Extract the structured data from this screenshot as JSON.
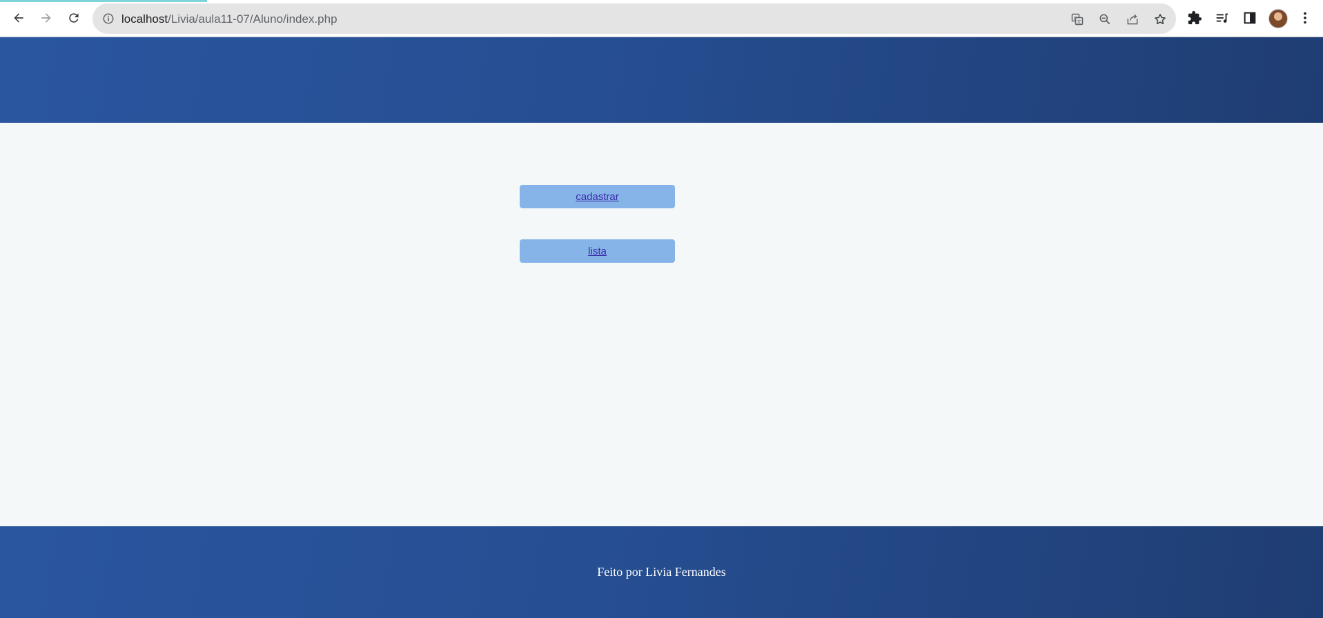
{
  "browser": {
    "url_host": "localhost",
    "url_path": "/Livia/aula11-07/Aluno/index.php",
    "icons": {
      "back": "arrow-left-icon",
      "forward": "arrow-right-icon",
      "reload": "reload-icon",
      "site_info": "info-icon",
      "translate": "translate-icon",
      "zoom": "zoom-out-icon",
      "share": "share-icon",
      "bookmark": "star-icon",
      "extensions": "puzzle-icon",
      "reading_list": "reading-list-icon",
      "side_panel": "side-panel-icon",
      "profile": "avatar",
      "menu": "more-vert-icon"
    }
  },
  "page": {
    "buttons": [
      {
        "label": "cadastrar"
      },
      {
        "label": "lista"
      }
    ],
    "footer": {
      "text": "Feito por Livia Fernandes"
    },
    "colors": {
      "header_bg": "#264e92",
      "footer_bg": "#264e92",
      "body_bg": "#f4f8f9",
      "button_bg": "#86b4e8",
      "link": "#3a2aa8"
    }
  }
}
